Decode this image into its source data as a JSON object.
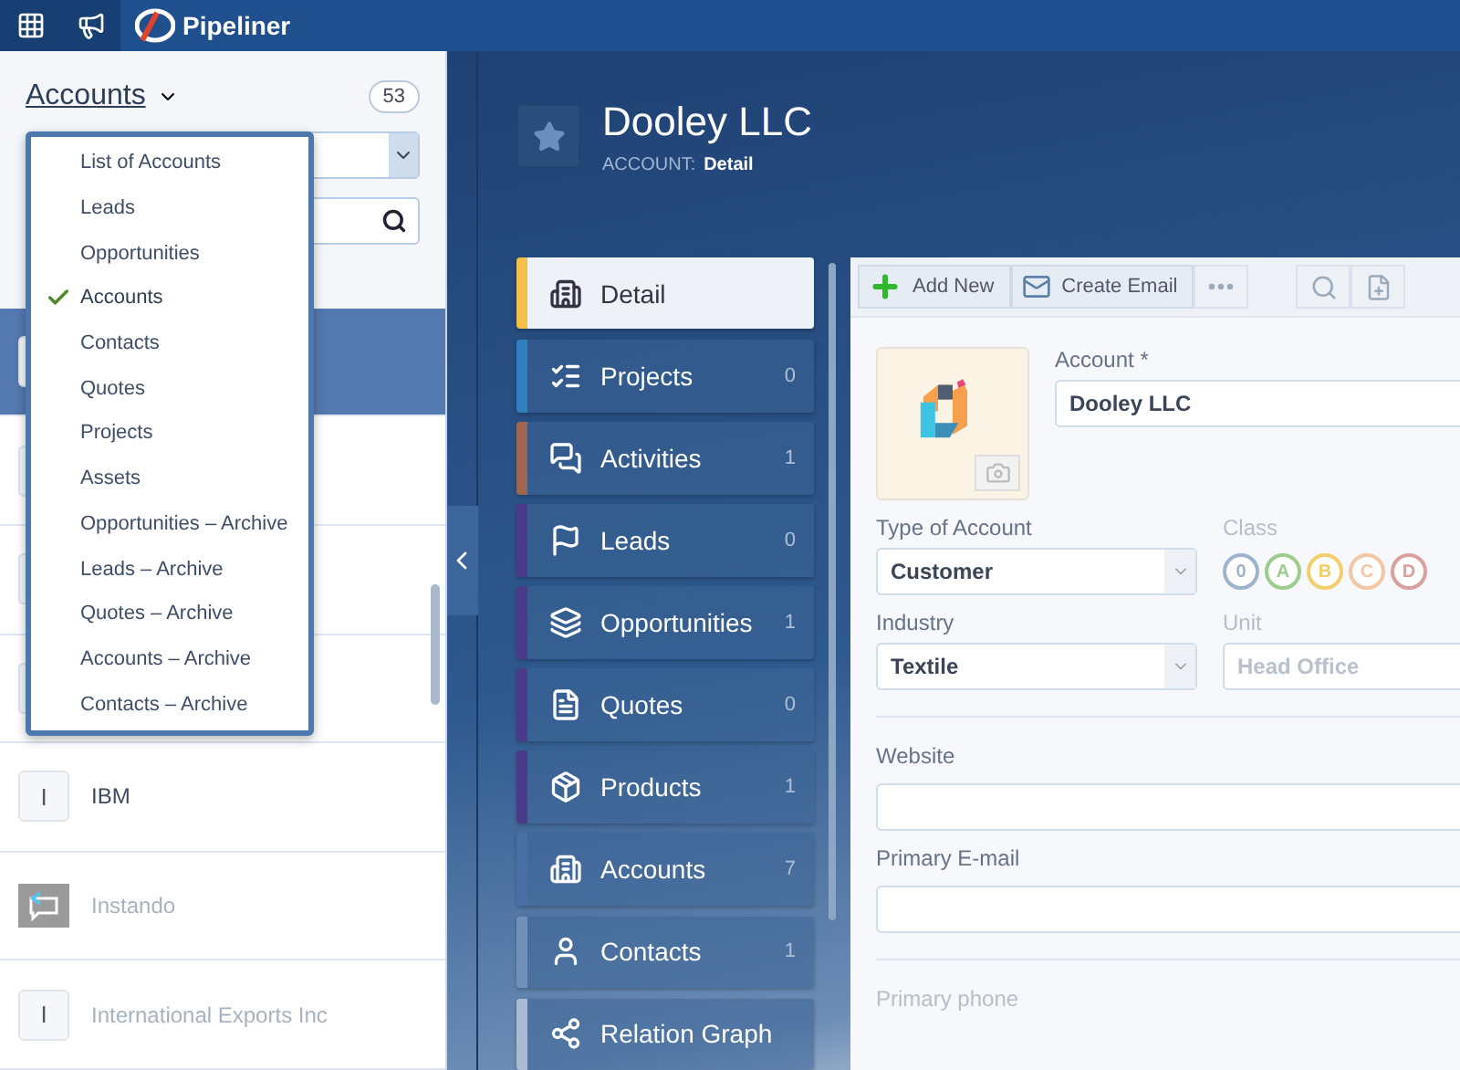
{
  "top_bar": {
    "app_name": "Pipeliner"
  },
  "left_panel": {
    "title": "Accounts",
    "count": "53",
    "view_menu": [
      {
        "label": "List of Accounts",
        "selected": false
      },
      {
        "label": "Leads",
        "selected": false
      },
      {
        "label": "Opportunities",
        "selected": false
      },
      {
        "label": "Accounts",
        "selected": true
      },
      {
        "label": "Contacts",
        "selected": false
      },
      {
        "label": "Quotes",
        "selected": false
      },
      {
        "label": "Projects",
        "selected": false
      },
      {
        "label": "Assets",
        "selected": false
      },
      {
        "label": "Opportunities – Archive",
        "selected": false
      },
      {
        "label": "Leads – Archive",
        "selected": false
      },
      {
        "label": "Quotes – Archive",
        "selected": false
      },
      {
        "label": "Accounts – Archive",
        "selected": false
      },
      {
        "label": "Contacts – Archive",
        "selected": false
      }
    ],
    "rows": [
      {
        "selected": true,
        "kind": "letter"
      },
      {
        "selected": false,
        "kind": "letter"
      },
      {
        "selected": false,
        "kind": "letter"
      },
      {
        "selected": false,
        "kind": "letter"
      },
      {
        "selected": false,
        "kind": "letter",
        "name": "IBM",
        "initial": "I"
      },
      {
        "selected": false,
        "kind": "image",
        "name": "Instando"
      },
      {
        "selected": false,
        "kind": "letter",
        "name": "International Exports Inc",
        "initial": "I"
      }
    ]
  },
  "record": {
    "title": "Dooley LLC",
    "type": "ACCOUNT:",
    "view": "Detail"
  },
  "nav": [
    {
      "label": "Detail",
      "color": "#f4c04a",
      "selected": true
    },
    {
      "label": "Projects",
      "count": "0",
      "color": "#2f7fc1",
      "selected": false
    },
    {
      "label": "Activities",
      "count": "1",
      "color": "#a0664f",
      "selected": false
    },
    {
      "label": "Leads",
      "count": "0",
      "color": "#4b3a8a",
      "selected": false
    },
    {
      "label": "Opportunities",
      "count": "1",
      "color": "#4b3a8a",
      "selected": false
    },
    {
      "label": "Quotes",
      "count": "0",
      "color": "#4b3a8a",
      "selected": false
    },
    {
      "label": "Products",
      "count": "1",
      "color": "#4b3a8a",
      "selected": false
    },
    {
      "label": "Accounts",
      "count": "7",
      "color": "#4a6fa5",
      "selected": false
    },
    {
      "label": "Contacts",
      "count": "1",
      "color": "#7390b8",
      "selected": false
    },
    {
      "label": "Relation Graph",
      "color": "#a9bcd4",
      "selected": false
    }
  ],
  "toolbar": [
    {
      "label": "Add New"
    },
    {
      "label": "Create Email"
    }
  ],
  "form": {
    "account_label": "Account *",
    "account_value": "Dooley LLC",
    "type_label": "Type of Account",
    "type_value": "Customer",
    "class_label": "Class",
    "classes": [
      {
        "label": "0",
        "color": "#9fb4cc",
        "selected": false
      },
      {
        "label": "A",
        "color": "#9ccc8e",
        "selected": false
      },
      {
        "label": "B",
        "color": "#f2cf6b",
        "selected": false
      },
      {
        "label": "C",
        "color": "#f3c6a6",
        "selected": false
      },
      {
        "label": "D",
        "color": "#d9a0a0",
        "selected": false
      }
    ],
    "industry_label": "Industry",
    "industry_value": "Textile",
    "unit_label": "Unit",
    "unit_value": "Head Office",
    "website_label": "Website",
    "email_label": "Primary E-mail",
    "phone_label": "Primary phone"
  }
}
